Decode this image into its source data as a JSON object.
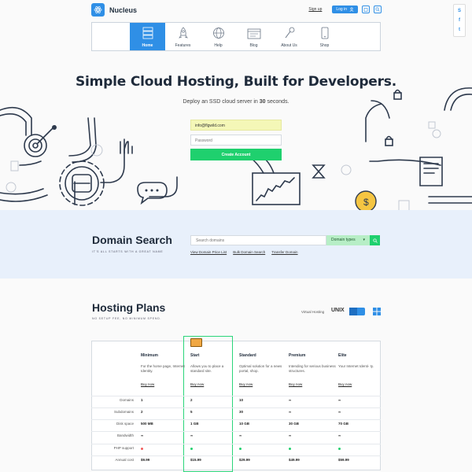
{
  "header": {
    "logo_text": "Nucleus",
    "signup": "Sign up",
    "login": "Log in"
  },
  "social": [
    "S",
    "f",
    "t"
  ],
  "nav": {
    "items": [
      {
        "label": "Home",
        "icon": "server-icon",
        "active": true
      },
      {
        "label": "Features",
        "icon": "rocket-icon",
        "active": false
      },
      {
        "label": "Help",
        "icon": "globe-icon",
        "active": false
      },
      {
        "label": "Blog",
        "icon": "browser-icon",
        "active": false
      },
      {
        "label": "About Us",
        "icon": "microphone-icon",
        "active": false
      },
      {
        "label": "Shop",
        "icon": "phone-icon",
        "active": false
      }
    ]
  },
  "hero": {
    "title": "Simple Cloud Hosting, Built for Developers.",
    "subtitle_pre": "Deploy an SSD cloud server in ",
    "subtitle_bold": "30",
    "subtitle_post": " seconds.",
    "email_value": "info@flgwild.com",
    "password_placeholder": "Password",
    "create_button": "Create Account"
  },
  "domain": {
    "title": "Domain Search",
    "subtitle": "IT'S ALL STARTS WITH A GREAT NAME",
    "search_placeholder": "Search domains",
    "select_value": "Domain types",
    "links": [
      "View Domain Price List",
      "Bulk Domain Search",
      "Transfer Domain"
    ]
  },
  "hosting": {
    "title": "Hosting Plans",
    "subtitle": "NO SETUP FEE, NO MINIMUM SPEND.",
    "virtual_label": "Virtual Hosting",
    "unix_label": "UNIX",
    "buy_label": "Buy now",
    "plans": [
      {
        "name": "Minimum",
        "desc": "For the home page, Internet Identity."
      },
      {
        "name": "Start",
        "desc": "Allows you to place a standard site."
      },
      {
        "name": "Standard",
        "desc": "Optimal solution for a news portal, shop."
      },
      {
        "name": "Premium",
        "desc": "Intending for serious business structures."
      },
      {
        "name": "Elite",
        "desc": "Your Internet Identi- ty."
      }
    ],
    "rows": [
      {
        "label": "Domains",
        "values": [
          "1",
          "2",
          "10",
          "∞",
          "∞"
        ]
      },
      {
        "label": "Subdomains",
        "values": [
          "2",
          "5",
          "30",
          "∞",
          "∞"
        ]
      },
      {
        "label": "Disk space",
        "values": [
          "500 MB",
          "1 GB",
          "10 GB",
          "30 GB",
          "70 GB"
        ]
      },
      {
        "label": "Bandwidth",
        "values": [
          "∞",
          "∞",
          "∞",
          "∞",
          "∞"
        ]
      },
      {
        "label": "PHP support",
        "values": [
          "red",
          "green",
          "green",
          "green",
          "green"
        ]
      },
      {
        "label": "Annual cost",
        "values": [
          "$9.99",
          "$15.99",
          "$29.99",
          "$49.99",
          "$59.99"
        ]
      }
    ]
  },
  "colors": {
    "accent": "#2f8fe6",
    "green": "#1fd06e",
    "domain_band": "#e8f0fb"
  }
}
